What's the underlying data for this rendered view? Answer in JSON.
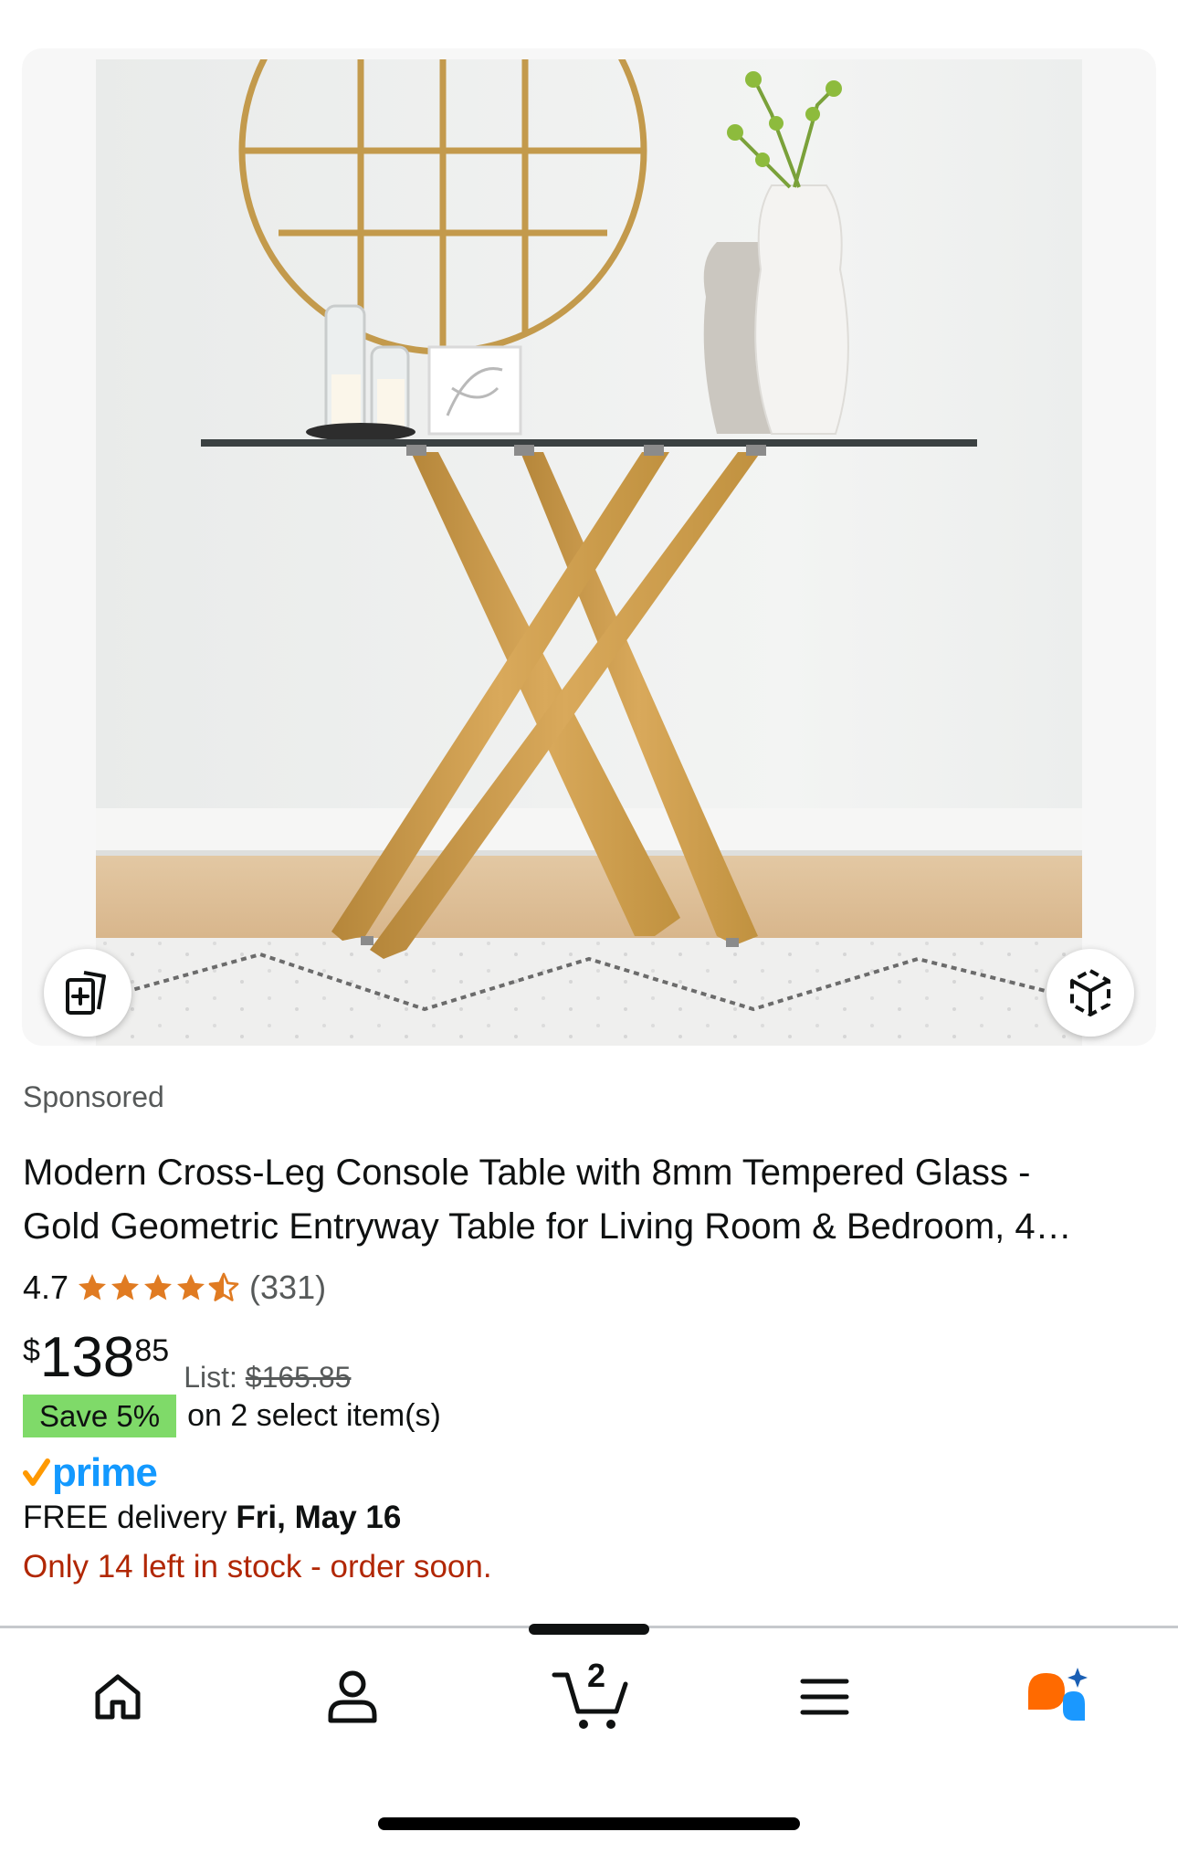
{
  "image_gallery": {
    "photo_alt": "Console table with gold cross legs and glass top",
    "compare_icon": "compare-icon",
    "view_3d_icon": "view-in-3d-icon"
  },
  "product": {
    "sponsored_label": "Sponsored",
    "title_line1": "Modern Cross-Leg Console Table with 8mm Tempered Glass -",
    "title_line2": "Gold Geometric Entryway Table for Living Room & Bedroom, 4…",
    "rating": {
      "value": "4.7",
      "stars": 4.5,
      "count": "(331)"
    },
    "price": {
      "currency": "$",
      "whole": "138",
      "fraction": "85",
      "list_label": "List:",
      "list_price": "$165.85"
    },
    "save": {
      "badge": "Save 5%",
      "text": "on 2 select item(s)"
    },
    "prime_label": "prime",
    "delivery": {
      "prefix": "FREE delivery",
      "date": "Fri, May 16"
    },
    "stock_text": "Only 14 left in stock - order soon."
  },
  "bottom_nav": {
    "items": [
      {
        "name": "home",
        "icon": "home-icon"
      },
      {
        "name": "account",
        "icon": "person-icon"
      },
      {
        "name": "cart",
        "icon": "cart-icon",
        "count": "2"
      },
      {
        "name": "menu",
        "icon": "hamburger-menu-icon"
      },
      {
        "name": "rufus",
        "icon": "rufus-ai-icon"
      }
    ]
  },
  "colors": {
    "accent_star": "#e07b22",
    "save_badge": "#7fda69",
    "stock_red": "#b12704",
    "prime_blue": "#1399ff",
    "prime_check": "#ff9900",
    "rufus_orange": "#ff6a00",
    "rufus_blue": "#1a98ff"
  }
}
